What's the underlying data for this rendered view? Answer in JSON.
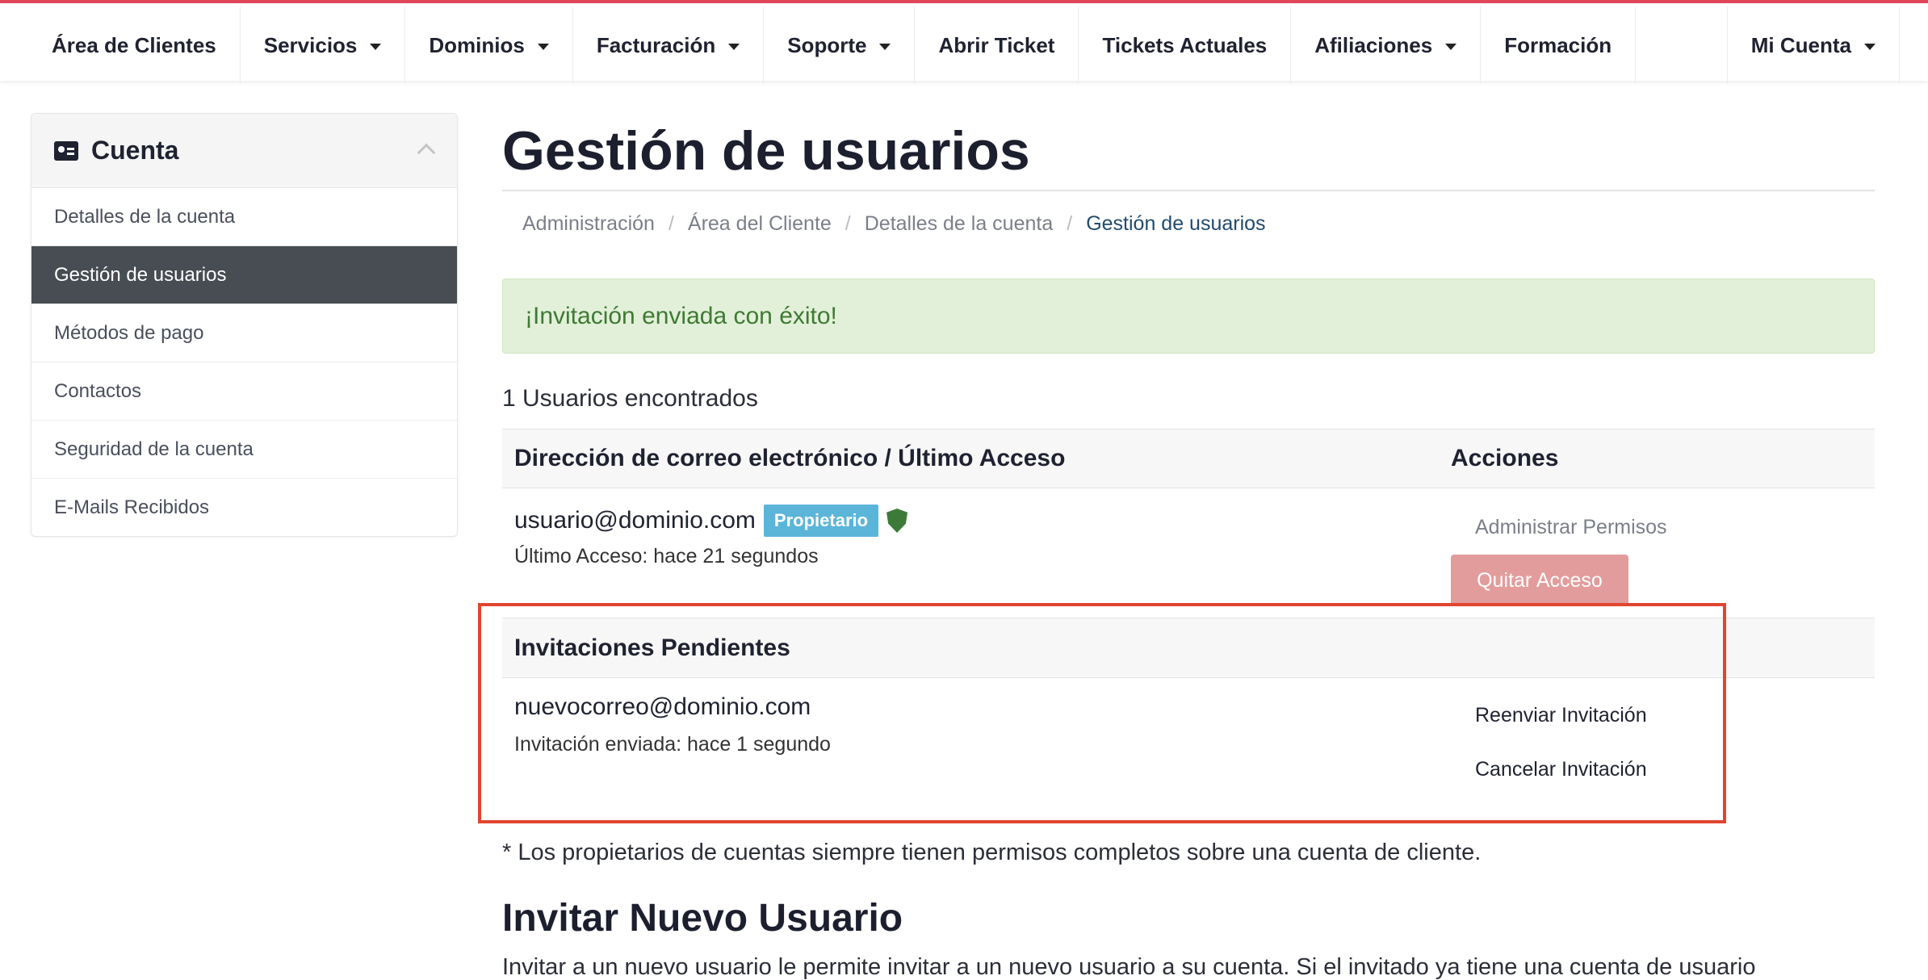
{
  "nav": {
    "items": [
      {
        "label": "Área de Clientes",
        "dropdown": false
      },
      {
        "label": "Servicios",
        "dropdown": true
      },
      {
        "label": "Dominios",
        "dropdown": true
      },
      {
        "label": "Facturación",
        "dropdown": true
      },
      {
        "label": "Soporte",
        "dropdown": true
      },
      {
        "label": "Abrir Ticket",
        "dropdown": false
      },
      {
        "label": "Tickets Actuales",
        "dropdown": false
      },
      {
        "label": "Afiliaciones",
        "dropdown": true
      },
      {
        "label": "Formación",
        "dropdown": false
      }
    ],
    "account": "Mi Cuenta"
  },
  "sidebar": {
    "title": "Cuenta",
    "items": [
      {
        "label": "Detalles de la cuenta"
      },
      {
        "label": "Gestión de usuarios",
        "active": true
      },
      {
        "label": "Métodos de pago"
      },
      {
        "label": "Contactos"
      },
      {
        "label": "Seguridad de la cuenta"
      },
      {
        "label": "E-Mails Recibidos"
      }
    ]
  },
  "page": {
    "title": "Gestión de usuarios",
    "breadcrumb": [
      "Administración",
      "Área del Cliente",
      "Detalles de la cuenta",
      "Gestión de usuarios"
    ],
    "alert": "¡Invitación enviada con éxito!",
    "count": "1 Usuarios encontrados",
    "table": {
      "col_email": "Dirección de correo electrónico / Último Acceso",
      "col_actions": "Acciones",
      "user": {
        "email": "usuario@dominio.com",
        "badge": "Propietario",
        "last_access": "Último Acceso: hace 21 segundos",
        "manage": "Administrar Permisos",
        "remove": "Quitar Acceso"
      },
      "pending_title": "Invitaciones Pendientes",
      "invite": {
        "email": "nuevocorreo@dominio.com",
        "sent": "Invitación enviada: hace 1 segundo",
        "resend": "Reenviar Invitación",
        "cancel": "Cancelar Invitación"
      }
    },
    "note": "* Los propietarios de cuentas siempre tienen permisos completos sobre una cuenta de cliente.",
    "invite_title": "Invitar Nuevo Usuario",
    "invite_text": "Invitar a un nuevo usuario le permite invitar a un nuevo usuario a su cuenta. Si el invitado ya tiene una cuenta de usuario"
  },
  "colors": {
    "accent": "#e0455a",
    "success_bg": "#e2f0d9",
    "badge": "#5bb5d9",
    "danger_btn": "#e39c9c",
    "highlight": "#e0452f"
  }
}
